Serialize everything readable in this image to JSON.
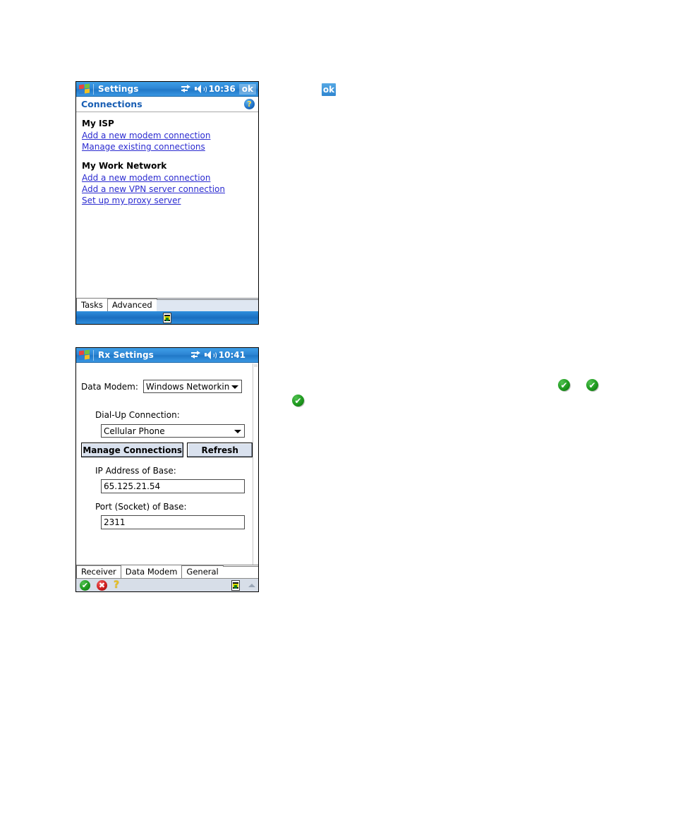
{
  "document": {
    "background_color": "#ffffff"
  },
  "device1": {
    "name": "connections-settings-screen",
    "titlebar": {
      "app_title": "Settings",
      "clock": "10:36",
      "ok_label": "ok",
      "icons": [
        "windows-flag-icon",
        "connectivity-icon",
        "speaker-icon"
      ]
    },
    "page_header": {
      "title": "Connections",
      "help_glyph": "?"
    },
    "groups": [
      {
        "title": "My ISP",
        "links": [
          "Add a new modem connection",
          "Manage existing connections"
        ]
      },
      {
        "title": "My Work Network",
        "links": [
          "Add a new modem connection",
          "Add a new VPN server connection",
          "Set up my proxy server"
        ]
      }
    ],
    "tabs": [
      {
        "label": "Tasks",
        "active": true
      },
      {
        "label": "Advanced",
        "active": false
      }
    ],
    "softbar": {
      "sip_icon": "keyboard-input-panel-icon"
    }
  },
  "device2": {
    "name": "rx-settings-screen",
    "titlebar": {
      "app_title": "Rx Settings",
      "clock": "10:41",
      "icons": [
        "windows-flag-icon",
        "connectivity-icon",
        "speaker-icon"
      ]
    },
    "fields": {
      "data_modem_label": "Data Modem:",
      "data_modem_value": "Windows Networking",
      "dialup_label": "Dial-Up Connection:",
      "dialup_value": "Cellular Phone",
      "manage_button": "Manage Connections",
      "refresh_button": "Refresh",
      "ip_label": "IP Address of Base:",
      "ip_value": "65.125.21.54",
      "port_label": "Port (Socket) of Base:",
      "port_value": "2311"
    },
    "tabs": [
      {
        "label": "Receiver",
        "active": false
      },
      {
        "label": "Data Modem",
        "active": true
      },
      {
        "label": "General",
        "active": false
      }
    ],
    "softbar": {
      "ok_glyph": "✔",
      "cancel_glyph": "✖",
      "help_glyph": "?",
      "sip_icon": "keyboard-input-panel-icon",
      "caret_icon": "chevron-up-icon"
    }
  },
  "callout_icons": {
    "ok_button": {
      "label": "ok",
      "color": "#3f96dc"
    },
    "check_marks": {
      "glyph": "✔",
      "color": "#1f9a1f",
      "count": 3
    }
  }
}
